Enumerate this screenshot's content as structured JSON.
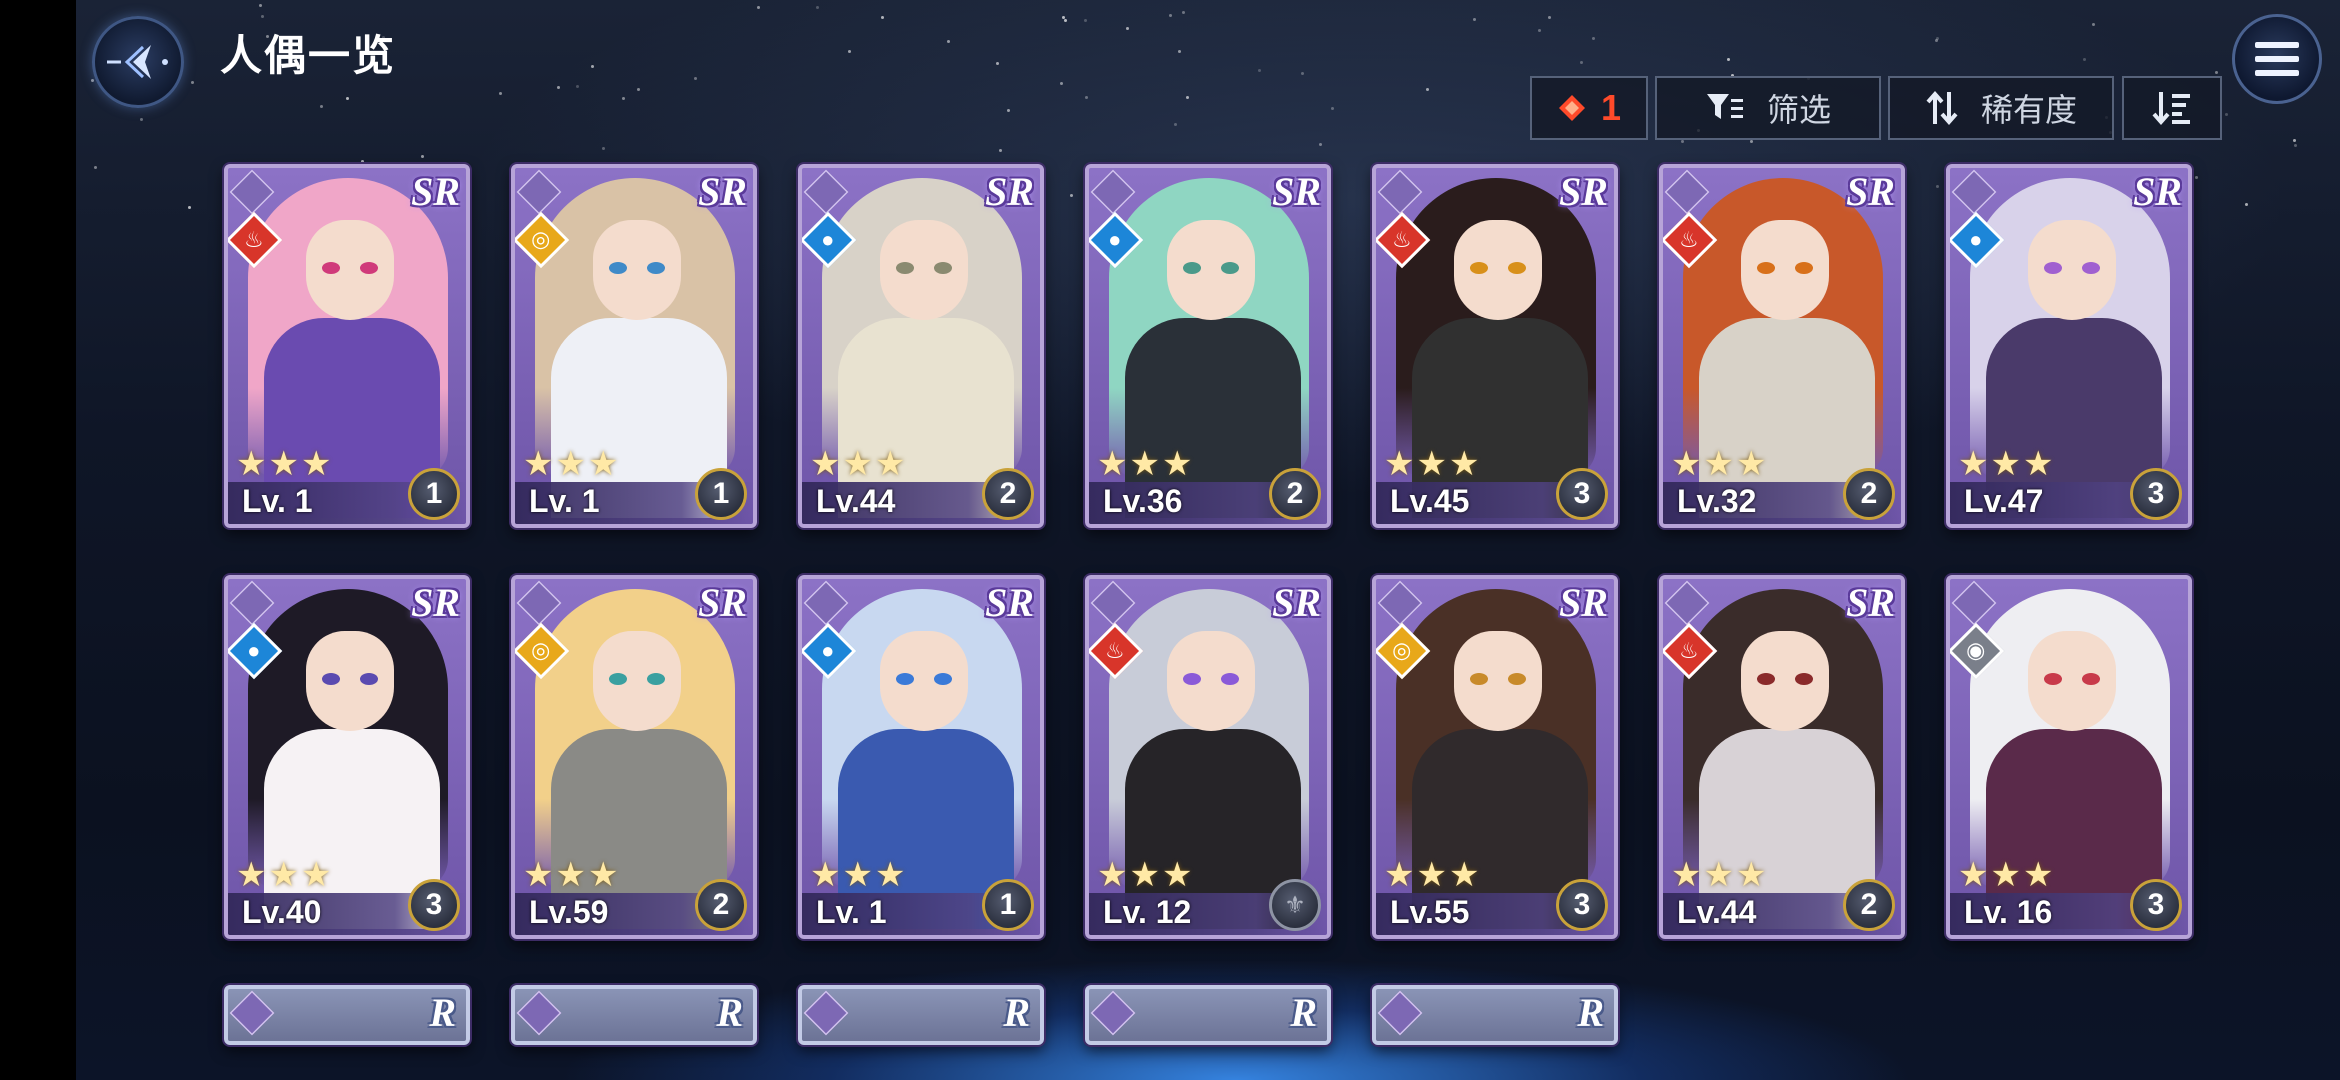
{
  "header": {
    "title": "人偶一览",
    "count": "1",
    "filter_label": "筛选",
    "sort_label": "稀有度"
  },
  "icons": {
    "back": "back-arrow-icon",
    "menu": "hamburger-menu-icon",
    "count": "red-diamond-icon",
    "filter": "filter-icon",
    "sort": "sort-arrows-icon",
    "order": "sort-order-icon"
  },
  "colors": {
    "fire": "#d8352a",
    "water": "#1d86d8",
    "light": "#e8a81a",
    "dark": "#7a7f8a",
    "accent": "#ff4a2a"
  },
  "cards": [
    {
      "rarity": "SR",
      "element": "fire",
      "stars": "★★★",
      "level": "Lv. 1",
      "awaken": "1",
      "hair": "#f0a6c8",
      "body": "#6a4bb0",
      "eye": "#d03a7a"
    },
    {
      "rarity": "SR",
      "element": "light",
      "stars": "★★★",
      "level": "Lv. 1",
      "awaken": "1",
      "hair": "#d9c2a6",
      "body": "#eef0f6",
      "eye": "#3f8ac8"
    },
    {
      "rarity": "SR",
      "element": "water",
      "stars": "★★★",
      "level": "Lv.44",
      "awaken": "2",
      "hair": "#d8d2c8",
      "body": "#e8e2d0",
      "eye": "#8a8a70"
    },
    {
      "rarity": "SR",
      "element": "water",
      "stars": "★★★",
      "level": "Lv.36",
      "awaken": "2",
      "hair": "#8fd6c2",
      "body": "#2a3038",
      "eye": "#4a9a8a"
    },
    {
      "rarity": "SR",
      "element": "fire",
      "stars": "★★★",
      "level": "Lv.45",
      "awaken": "3",
      "hair": "#2a1c1c",
      "body": "#303030",
      "eye": "#d8901a"
    },
    {
      "rarity": "SR",
      "element": "fire",
      "stars": "★★★",
      "level": "Lv.32",
      "awaken": "2",
      "hair": "#c8582a",
      "body": "#d8d2c8",
      "eye": "#d8701a"
    },
    {
      "rarity": "SR",
      "element": "water",
      "stars": "★★★",
      "level": "Lv.47",
      "awaken": "3",
      "hair": "#d8d2ea",
      "body": "#4a3a6a",
      "eye": "#a060d0"
    },
    {
      "rarity": "SR",
      "element": "water",
      "stars": "★★★",
      "level": "Lv.40",
      "awaken": "3",
      "hair": "#1e1a26",
      "body": "#f6f2f4",
      "eye": "#5a4ab0"
    },
    {
      "rarity": "SR",
      "element": "light",
      "stars": "★★★",
      "level": "Lv.59",
      "awaken": "2",
      "hair": "#f2d08a",
      "body": "#8a8a86",
      "eye": "#3aa0a0"
    },
    {
      "rarity": "SR",
      "element": "water",
      "stars": "★★★",
      "level": "Lv. 1",
      "awaken": "1",
      "hair": "#c8d8f0",
      "body": "#3a5ab0",
      "eye": "#3a7ad8"
    },
    {
      "rarity": "SR",
      "element": "fire",
      "stars": "★★★",
      "level": "Lv. 12",
      "awaken": "",
      "hair": "#c8ccd8",
      "body": "#262428",
      "eye": "#8a5ad8"
    },
    {
      "rarity": "SR",
      "element": "light",
      "stars": "★★★",
      "level": "Lv.55",
      "awaken": "3",
      "hair": "#4a3026",
      "body": "#302a2c",
      "eye": "#c88a2a"
    },
    {
      "rarity": "SR",
      "element": "fire",
      "stars": "★★★",
      "level": "Lv.44",
      "awaken": "2",
      "hair": "#3a2c2a",
      "body": "#d8d2d6",
      "eye": "#8a2a2a"
    },
    {
      "rarity": "",
      "element": "dark",
      "stars": "★★★",
      "level": "Lv. 16",
      "awaken": "3",
      "hair": "#eeeef2",
      "body": "#5a2a4a",
      "eye": "#c83a4a"
    }
  ],
  "partial_cards": [
    {
      "rarity": "R"
    },
    {
      "rarity": "R"
    },
    {
      "rarity": "R"
    },
    {
      "rarity": "R"
    },
    {
      "rarity": "R"
    }
  ]
}
